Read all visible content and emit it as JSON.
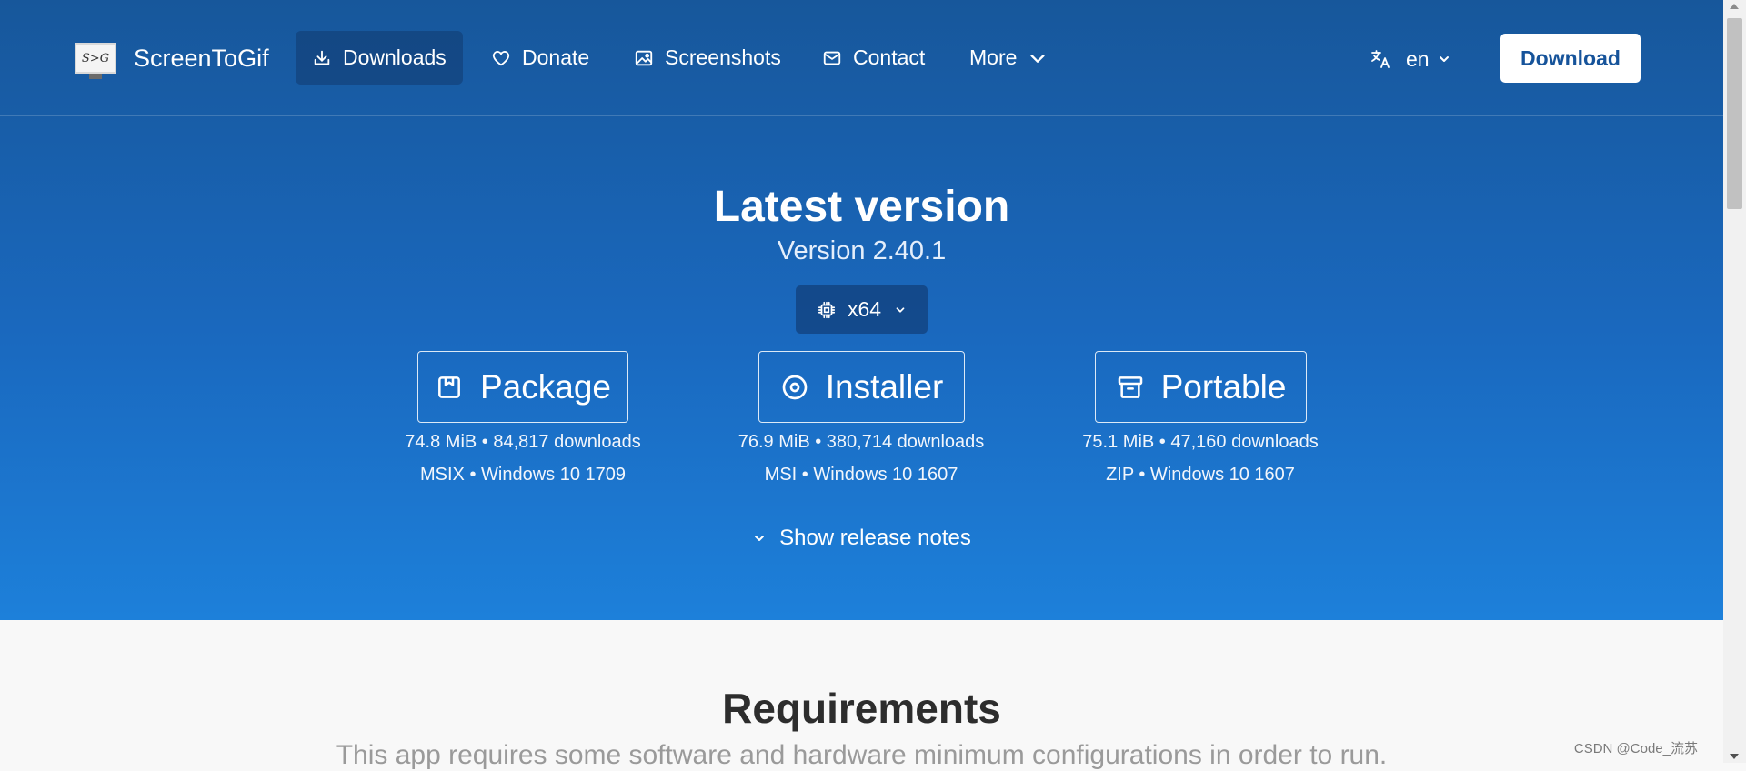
{
  "brand": {
    "logo_text": "S>G",
    "name": "ScreenToGif"
  },
  "nav": {
    "items": [
      {
        "label": "Downloads",
        "icon": "download-icon",
        "active": true
      },
      {
        "label": "Donate",
        "icon": "heart-icon"
      },
      {
        "label": "Screenshots",
        "icon": "image-icon"
      },
      {
        "label": "Contact",
        "icon": "mail-icon"
      },
      {
        "label": "More",
        "icon": "chevron-down-icon"
      }
    ],
    "language": "en",
    "download_button": "Download"
  },
  "hero": {
    "title": "Latest version",
    "version": "Version 2.40.1",
    "architecture": "x64",
    "options": [
      {
        "label": "Package",
        "icon": "package-icon",
        "stats": "74.8 MiB • 84,817 downloads",
        "details": "MSIX • Windows 10 1709"
      },
      {
        "label": "Installer",
        "icon": "disc-icon",
        "stats": "76.9 MiB • 380,714 downloads",
        "details": "MSI • Windows 10 1607"
      },
      {
        "label": "Portable",
        "icon": "archive-icon",
        "stats": "75.1 MiB • 47,160 downloads",
        "details": "ZIP • Windows 10 1607"
      }
    ],
    "release_notes_toggle": "Show release notes"
  },
  "requirements": {
    "title": "Requirements",
    "subtitle": "This app requires some software and hardware minimum configurations in order to run."
  },
  "watermark": "CSDN @Code_流苏"
}
